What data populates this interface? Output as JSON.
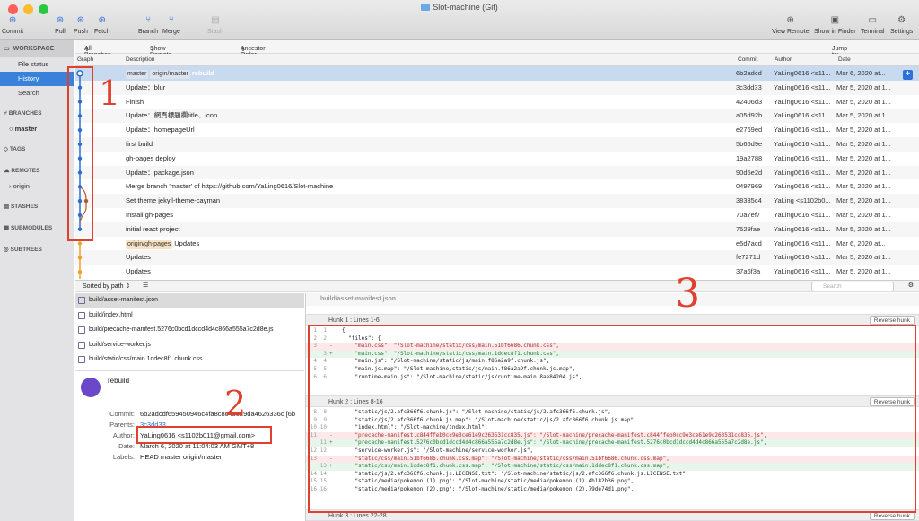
{
  "window": {
    "title": "Slot-machine (Git)"
  },
  "toolbar": {
    "commit": "Commit",
    "pull": "Pull",
    "push": "Push",
    "fetch": "Fetch",
    "branch": "Branch",
    "merge": "Merge",
    "stash": "Stash",
    "view_remote": "View Remote",
    "show_finder": "Show in Finder",
    "terminal": "Terminal",
    "settings": "Settings"
  },
  "sidebar": {
    "workspace": "WORKSPACE",
    "items": [
      "File status",
      "History",
      "Search"
    ],
    "branches": "BRANCHES",
    "master": "master",
    "tags": "TAGS",
    "remotes": "REMOTES",
    "origin": "origin",
    "stashes": "STASHES",
    "submodules": "SUBMODULES",
    "subtrees": "SUBTREES"
  },
  "filters": {
    "branches": "All Branches",
    "remote": "Show Remote Branches",
    "order": "Ancestor Order",
    "jump": "Jump to:"
  },
  "columns": {
    "graph": "Graph",
    "description": "Description",
    "commit": "Commit",
    "author": "Author",
    "date": "Date"
  },
  "commits": [
    {
      "tags": [
        "master",
        "origin/master"
      ],
      "desc": "rebuild",
      "hash": "6b2adcd",
      "author": "YaLing0616 <s11...",
      "date": "Mar 6, 2020 at..."
    },
    {
      "tags": [],
      "desc": "Update：blur",
      "hash": "3c3dd33",
      "author": "YaLing0616 <s11...",
      "date": "Mar 5, 2020 at 1..."
    },
    {
      "tags": [],
      "desc": "Finish",
      "hash": "42406d3",
      "author": "YaLing0616 <s11...",
      "date": "Mar 5, 2020 at 1..."
    },
    {
      "tags": [],
      "desc": "Update：網頁標題欄title、icon",
      "hash": "a05d92b",
      "author": "YaLing0616 <s11...",
      "date": "Mar 5, 2020 at 1..."
    },
    {
      "tags": [],
      "desc": "Update：homepageUrl",
      "hash": "e2769ed",
      "author": "YaLing0616 <s11...",
      "date": "Mar 5, 2020 at 1..."
    },
    {
      "tags": [],
      "desc": "first build",
      "hash": "5b65d9e",
      "author": "YaLing0616 <s11...",
      "date": "Mar 5, 2020 at 1..."
    },
    {
      "tags": [],
      "desc": "gh-pages deploy",
      "hash": "19a2788",
      "author": "YaLing0616 <s11...",
      "date": "Mar 5, 2020 at 1..."
    },
    {
      "tags": [],
      "desc": "Update：package.json",
      "hash": "90d5e2d",
      "author": "YaLing0616 <s11...",
      "date": "Mar 5, 2020 at 1..."
    },
    {
      "tags": [],
      "desc": "Merge branch 'master' of https://github.com/YaLing0616/Slot-machine",
      "hash": "0497969",
      "author": "YaLing0616 <s11...",
      "date": "Mar 5, 2020 at 1..."
    },
    {
      "tags": [],
      "desc": "Set theme jekyll-theme-cayman",
      "hash": "38335c4",
      "author": "YaLing <s1102b0...",
      "date": "Mar 5, 2020 at 1..."
    },
    {
      "tags": [],
      "desc": "Install gh-pages",
      "hash": "70a7ef7",
      "author": "YaLing0616 <s11...",
      "date": "Mar 5, 2020 at 1..."
    },
    {
      "tags": [],
      "desc": "initial react project",
      "hash": "7529fae",
      "author": "YaLing0616 <s11...",
      "date": "Mar 5, 2020 at 1..."
    },
    {
      "tags": [
        "origin/gh-pages"
      ],
      "desc": "Updates",
      "hash": "e5d7acd",
      "author": "YaLing0616 <s11...",
      "date": "Mar 6, 2020 at..."
    },
    {
      "tags": [],
      "desc": "Updates",
      "hash": "fe7271d",
      "author": "YaLing0616 <s11...",
      "date": "Mar 5, 2020 at 1..."
    },
    {
      "tags": [],
      "desc": "Updates",
      "hash": "37a6f3a",
      "author": "YaLing0616 <s11...",
      "date": "Mar 5, 2020 at 1..."
    }
  ],
  "lower": {
    "sort": "Sorted by path",
    "search_placeholder": "Search"
  },
  "files": [
    "build/asset-manifest.json",
    "build/index.html",
    "build/precache-manifest.5276c0bcd1dccd4d4c866a555a7c2d8e.js",
    "build/service-worker.js",
    "build/static/css/main.1ddec8f1.chunk.css"
  ],
  "details": {
    "message": "rebuild",
    "commit_label": "Commit:",
    "commit": "6b2adcdf659450946c4fa8c8c43029da4626336c [6b",
    "parents_label": "Parents:",
    "parents": "3c3dd33",
    "author_label": "Author:",
    "author": "YaLing0616 <s1102b011@gmail.com>",
    "date_label": "Date:",
    "date": "March 6, 2020 at 11:04:03 AM GMT+8",
    "labels_label": "Labels:",
    "labels": "HEAD master origin/master"
  },
  "diff": {
    "file": "build/asset-manifest.json",
    "reverse": "Reverse hunk",
    "hunk1": "Hunk 1 : Lines 1-6",
    "hunk2": "Hunk 2 : Lines 8-16",
    "hunk3": "Hunk 3 : Lines 22-28",
    "h1_lines": [
      {
        "o": "1",
        "n": "1",
        "s": " ",
        "t": "{",
        "k": ""
      },
      {
        "o": "2",
        "n": "2",
        "s": " ",
        "t": "  \"files\": {",
        "k": ""
      },
      {
        "o": "3",
        "n": "",
        "s": "-",
        "t": "    \"main.css\": \"/Slot-machine/static/css/main.51bf6686.chunk.css\",",
        "k": "del"
      },
      {
        "o": "",
        "n": "3",
        "s": "+",
        "t": "    \"main.css\": \"/Slot-machine/static/css/main.1ddec8f1.chunk.css\",",
        "k": "add"
      },
      {
        "o": "4",
        "n": "4",
        "s": " ",
        "t": "    \"main.js\": \"/Slot-machine/static/js/main.f86a2a9f.chunk.js\",",
        "k": ""
      },
      {
        "o": "5",
        "n": "5",
        "s": " ",
        "t": "    \"main.js.map\": \"/Slot-machine/static/js/main.f86a2a9f.chunk.js.map\",",
        "k": ""
      },
      {
        "o": "6",
        "n": "6",
        "s": " ",
        "t": "    \"runtime-main.js\": \"/Slot-machine/static/js/runtime-main.8ae84204.js\",",
        "k": ""
      }
    ],
    "h2_lines": [
      {
        "o": "8",
        "n": "8",
        "s": " ",
        "t": "    \"static/js/2.afc366f6.chunk.js\": \"/Slot-machine/static/js/2.afc366f6.chunk.js\",",
        "k": ""
      },
      {
        "o": "9",
        "n": "9",
        "s": " ",
        "t": "    \"static/js/2.afc366f6.chunk.js.map\": \"/Slot-machine/static/js/2.afc366f6.chunk.js.map\",",
        "k": ""
      },
      {
        "o": "10",
        "n": "10",
        "s": " ",
        "t": "    \"index.html\": \"/Slot-machine/index.html\",",
        "k": ""
      },
      {
        "o": "11",
        "n": "",
        "s": "-",
        "t": "    \"precache-manifest.c844ffeb0cc9e3ce61e9c263531cc835.js\": \"/Slot-machine/precache-manifest.c844ffeb0cc9e3ce61e9c263531cc835.js\",",
        "k": "del"
      },
      {
        "o": "",
        "n": "11",
        "s": "+",
        "t": "    \"precache-manifest.5276c0bcd1dccd4d4c866a555a7c2d8e.js\": \"/Slot-machine/precache-manifest.5276c0bcd1dccd4d4c866a555a7c2d8e.js\",",
        "k": "add"
      },
      {
        "o": "12",
        "n": "12",
        "s": " ",
        "t": "    \"service-worker.js\": \"/Slot-machine/service-worker.js\",",
        "k": ""
      },
      {
        "o": "13",
        "n": "",
        "s": "-",
        "t": "    \"static/css/main.51bf6686.chunk.css.map\": \"/Slot-machine/static/css/main.51bf6686.chunk.css.map\",",
        "k": "del"
      },
      {
        "o": "",
        "n": "13",
        "s": "+",
        "t": "    \"static/css/main.1ddec8f1.chunk.css.map\": \"/Slot-machine/static/css/main.1ddec8f1.chunk.css.map\",",
        "k": "add"
      },
      {
        "o": "14",
        "n": "14",
        "s": " ",
        "t": "    \"static/js/2.afc366f6.chunk.js.LICENSE.txt\": \"/Slot-machine/static/js/2.afc366f6.chunk.js.LICENSE.txt\",",
        "k": ""
      },
      {
        "o": "15",
        "n": "15",
        "s": " ",
        "t": "    \"static/media/pokemon (1).png\": \"/Slot-machine/static/media/pokemon (1).4b182b36.png\",",
        "k": ""
      },
      {
        "o": "16",
        "n": "16",
        "s": " ",
        "t": "    \"static/media/pokemon (2).png\": \"/Slot-machine/static/media/pokemon (2).79de74d1.png\",",
        "k": ""
      }
    ]
  },
  "annotations": {
    "n1": "1",
    "n2": "2",
    "n3": "3"
  },
  "colors": {
    "accent": "#3a82d9",
    "annotation": "#e0402e",
    "graph_blue": "#2d6fd0",
    "graph_orange": "#f0a030"
  }
}
